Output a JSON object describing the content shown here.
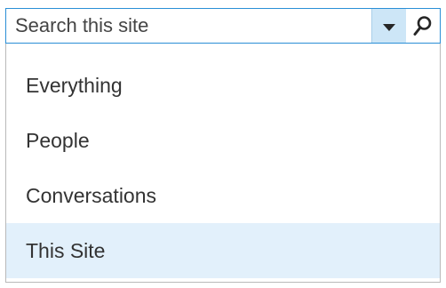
{
  "search": {
    "placeholder": "Search this site"
  },
  "icons": {
    "dropdown": "chevron-down-icon",
    "search": "magnifier-icon"
  },
  "menu": {
    "items": [
      {
        "label": "Everything"
      },
      {
        "label": "People"
      },
      {
        "label": "Conversations"
      },
      {
        "label": "This Site"
      }
    ],
    "selected_index": 3
  },
  "colors": {
    "border_accent": "#2a8fd6",
    "dropdown_bg": "#cde6f7",
    "selected_bg": "#e2f0fb"
  }
}
